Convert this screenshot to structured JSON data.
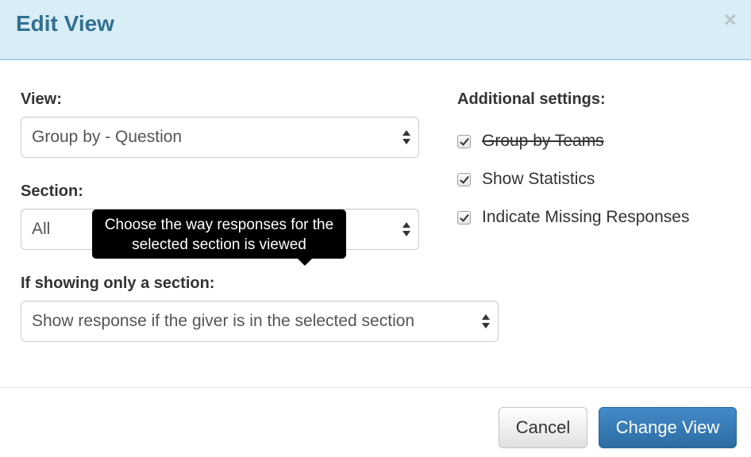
{
  "modal": {
    "title": "Edit View",
    "close_glyph": "×"
  },
  "form": {
    "view": {
      "label": "View:",
      "selected": "Group by - Question"
    },
    "section": {
      "label": "Section:",
      "selected": "All"
    },
    "section_detail": {
      "label": "If showing only a section:",
      "selected": "Show response if the giver is in the selected section"
    }
  },
  "tooltip": {
    "line1": "Choose the way responses for the",
    "line2": "selected section is viewed"
  },
  "additional_settings": {
    "label": "Additional settings:",
    "options": [
      {
        "label": "Group by Teams",
        "checked": true,
        "disabled": true
      },
      {
        "label": "Show Statistics",
        "checked": true,
        "disabled": false
      },
      {
        "label": "Indicate Missing Responses",
        "checked": true,
        "disabled": false
      }
    ]
  },
  "footer": {
    "cancel_label": "Cancel",
    "submit_label": "Change View"
  }
}
